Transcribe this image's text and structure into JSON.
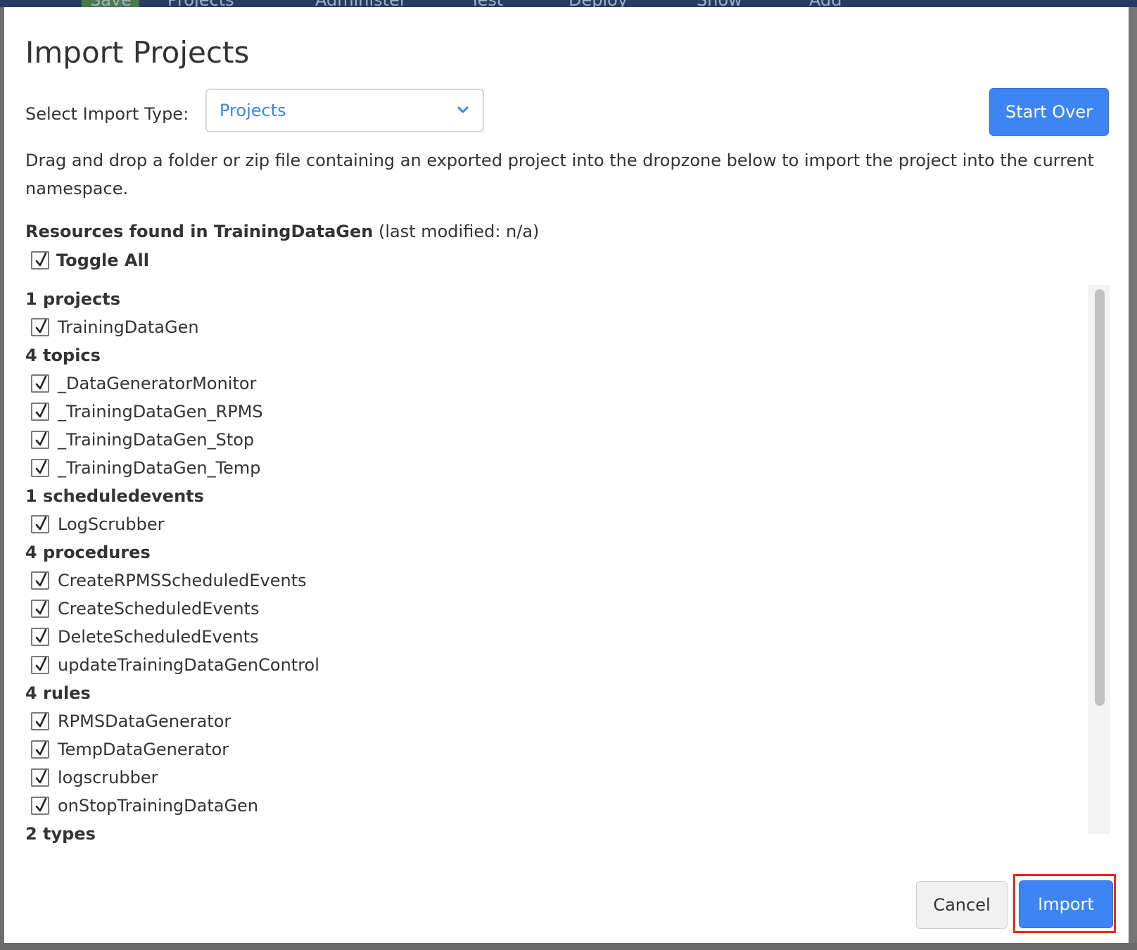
{
  "background": {
    "menu_items": [
      "Save",
      "Projects",
      "Administer",
      "Test",
      "Deploy",
      "Show",
      "Add"
    ]
  },
  "modal": {
    "title": "Import Projects",
    "import_type_label": "Select Import Type:",
    "import_type_value": "Projects",
    "start_over_label": "Start Over",
    "description": "Drag and drop a folder or zip file containing an exported project into the dropzone below to import the project into the current namespace.",
    "resources_prefix": "Resources found in TrainingDataGen",
    "resources_suffix": " (last modified: n/a)",
    "toggle_all_label": "Toggle All",
    "toggle_all_checked": true,
    "groups": [
      {
        "heading": "1 projects",
        "items": [
          "TrainingDataGen"
        ]
      },
      {
        "heading": "4 topics",
        "items": [
          "_DataGeneratorMonitor",
          "_TrainingDataGen_RPMS",
          "_TrainingDataGen_Stop",
          "_TrainingDataGen_Temp"
        ]
      },
      {
        "heading": "1 scheduledevents",
        "items": [
          "LogScrubber"
        ]
      },
      {
        "heading": "4 procedures",
        "items": [
          "CreateRPMSScheduledEvents",
          "CreateScheduledEvents",
          "DeleteScheduledEvents",
          "updateTrainingDataGenControl"
        ]
      },
      {
        "heading": "4 rules",
        "items": [
          "RPMSDataGenerator",
          "TempDataGenerator",
          "logscrubber",
          "onStopTrainingDataGen"
        ]
      },
      {
        "heading": "2 types",
        "items": []
      }
    ],
    "cancel_label": "Cancel",
    "import_label": "Import"
  },
  "colors": {
    "primary": "#3c85f2",
    "select_text": "#3c82f0",
    "highlight": "#e8291c"
  }
}
